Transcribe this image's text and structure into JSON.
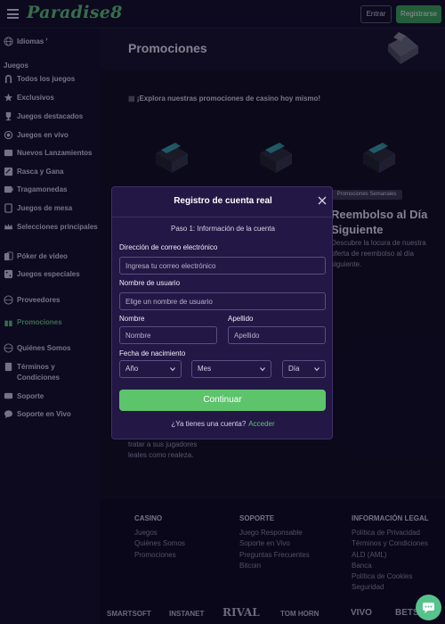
{
  "header": {
    "logo": "Paradise8",
    "login_label": "Entrar",
    "register_label": "Registrarse"
  },
  "sidebar": {
    "languages": "Idiomas",
    "games_header": "Juegos",
    "items": [
      {
        "label": "Todos los juegos",
        "icon": "horseshoe-icon"
      },
      {
        "label": "Exclusivos",
        "icon": "star-icon"
      },
      {
        "label": "Juegos destacados",
        "icon": "trophy-icon"
      },
      {
        "label": "Juegos en vivo",
        "icon": "live-icon"
      },
      {
        "label": "Nuevos Lanzamientos",
        "icon": "new-icon"
      },
      {
        "label": "Rasca y Gana",
        "icon": "scratch-icon"
      },
      {
        "label": "Tragamonedas",
        "icon": "slot-icon"
      },
      {
        "label": "Juegos de mesa",
        "icon": "table-icon"
      },
      {
        "label": "Selecciones principales",
        "icon": "crown-icon"
      },
      {
        "label": "Póker de video",
        "icon": "cards-icon"
      },
      {
        "label": "Juegos especiales",
        "icon": "dice-icon"
      }
    ],
    "providers": "Proveedores",
    "promotions": "Promociones",
    "about": "Quiénes Somos",
    "terms": "Términos y Condiciones",
    "support": "Soporte",
    "live_support": "Soporte en Vivo"
  },
  "main": {
    "title": "Promociones",
    "explore": "¡Explora nuestras promociones de casino hoy mismo!",
    "promo": {
      "tag": "Promociones Semanales",
      "title": "Reembolso al Día Siguiente",
      "description": "Descubre la locura de nuestra oferta de reembolso al día siguiente."
    },
    "card_desc": "tratar a sus jugadores leales como realeza."
  },
  "footer": {
    "casino": {
      "title": "CASINO",
      "links": [
        "Juegos",
        "Quiénes Somos",
        "Promociones"
      ]
    },
    "support": {
      "title": "SOPORTE",
      "links": [
        "Juego Responsable",
        "Soporte en Vivo",
        "Preguntas Frecuentes",
        "Bitcoin"
      ]
    },
    "legal": {
      "title": "INFORMACIÓN LEGAL",
      "links": [
        "Política de Privacidad",
        "Términos y Condiciones",
        "ALD (AML)",
        "Banca",
        "Política de Cookies",
        "Seguridad"
      ]
    },
    "partners": [
      "SMARTSOFT",
      "INSTANET",
      "RIVAL",
      "TOM HORN",
      "VIVO",
      "BETSOFT"
    ]
  },
  "modal": {
    "title": "Registro de cuenta real",
    "step": "Paso 1: Información de la cuenta",
    "email_label": "Dirección de correo electrónico",
    "email_placeholder": "Ingresa tu correo electrónico",
    "username_label": "Nombre de usuario",
    "username_placeholder": "Elige un nombre de usuario",
    "first_name_label": "Nombre",
    "first_name_placeholder": "Nombre",
    "last_name_label": "Apellido",
    "last_name_placeholder": "Apellido",
    "dob_label": "Fecha de nacimiento",
    "year": "Año",
    "month": "Mes",
    "day": "Día",
    "continue_label": "Continuar",
    "have_account": "¿Ya tienes una cuenta?",
    "login_link": "Acceder"
  },
  "colors": {
    "accent": "#5dc46c",
    "background": "#0f0b22",
    "modal": "#231745"
  }
}
